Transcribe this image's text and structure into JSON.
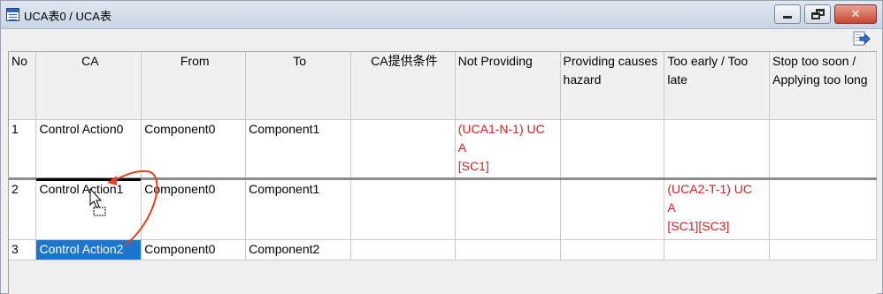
{
  "window": {
    "title": "UCA表0 / UCA表",
    "minimize_label": "",
    "maximize_label": "",
    "close_label": "✕"
  },
  "table": {
    "headers": {
      "no": "No",
      "ca": "CA",
      "from": "From",
      "to": "To",
      "ca_condition": "CA提供条件",
      "not_providing": "Not Providing",
      "providing_hazard": "Providing causes hazard",
      "too_early_late": "Too early / Too late",
      "stop_too_soon": "Stop too soon / Applying too long"
    },
    "rows": [
      {
        "no": "1",
        "ca": "Control Action0",
        "from": "Component0",
        "to": "Component1",
        "ca_condition": "",
        "not_providing": [
          "(UCA1-N-1) UC",
          "A",
          "[SC1]"
        ],
        "providing_hazard": "",
        "too_early_late": [],
        "stop_too_soon": ""
      },
      {
        "no": "2",
        "ca": "Control Action1",
        "from": "Component0",
        "to": "Component1",
        "ca_condition": "",
        "not_providing": [],
        "providing_hazard": "",
        "too_early_late": [
          "(UCA2-T-1) UC",
          "A",
          "[SC1][SC3]"
        ],
        "stop_too_soon": ""
      },
      {
        "no": "3",
        "ca": "Control Action2",
        "from": "Component0",
        "to": "Component2",
        "ca_condition": "",
        "not_providing": [],
        "providing_hazard": "",
        "too_early_late": [],
        "stop_too_soon": ""
      }
    ]
  },
  "colors": {
    "uca_text": "#d02020",
    "selection": "#1f74cc",
    "drag_arrow": "#e0401c"
  },
  "icons": {
    "app": "uca-table-icon",
    "export": "export-arrow-icon",
    "cursor": "drag-copy-cursor-icon"
  }
}
